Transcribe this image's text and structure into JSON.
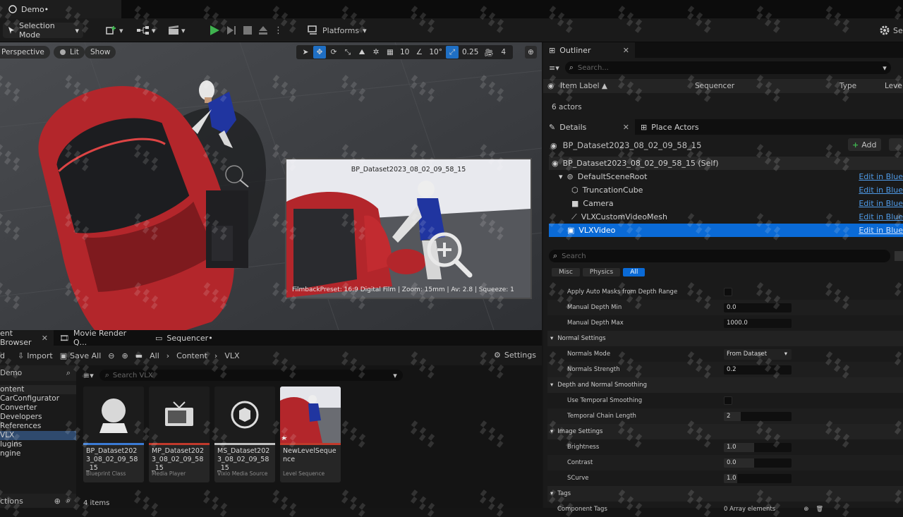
{
  "app": {
    "doc_tab": "Demo•"
  },
  "toolbar": {
    "selection_mode": "Selection Mode",
    "platforms": "Platforms",
    "settings": "Sett"
  },
  "viewport": {
    "perspective": "Perspective",
    "lit": "Lit",
    "show": "Show",
    "grid_snap": "10",
    "angle_snap": "10°",
    "scale_snap": "0.25",
    "cam_speed": "4",
    "pip_title": "BP_Dataset2023_08_02_09_58_15",
    "pip_footer": "FilmbackPreset: 16:9 Digital Film | Zoom: 15mm | Av: 2.8 | Squeeze: 1"
  },
  "content_browser": {
    "tabs": [
      {
        "label": "ent Browser"
      },
      {
        "label": "Movie Render Q..."
      },
      {
        "label": "Sequencer•"
      }
    ],
    "add": "d",
    "import": "Import",
    "save_all": "Save All",
    "path": [
      "All",
      "Content",
      "VLX"
    ],
    "settings": "Settings",
    "search_placeholder": "Search VLX",
    "tree_root": "Demo",
    "tree": [
      {
        "label": "ontent"
      },
      {
        "label": "CarConfigurator"
      },
      {
        "label": "Converter"
      },
      {
        "label": "Developers"
      },
      {
        "label": "References"
      },
      {
        "label": "VLX"
      },
      {
        "label": "lugins"
      },
      {
        "label": "ngine"
      }
    ],
    "collections": "ctions",
    "item_count": "4 items",
    "assets": [
      {
        "name": "BP_Dataset2023_08_02_09_58_15",
        "type": "Blueprint Class",
        "color": "#3a7bd5"
      },
      {
        "name": "MP_Dataset2023_08_02_09_58_15",
        "type": "Media Player",
        "color": "#c0392b"
      },
      {
        "name": "MS_Dataset2023_08_02_09_58_15",
        "type": "Vlxio Media Source",
        "color": "#c0c0c0"
      },
      {
        "name": "NewLevelSequence",
        "type": "Level Sequence",
        "color": "#c0392b"
      }
    ]
  },
  "outliner": {
    "tab": "Outliner",
    "search_placeholder": "Search...",
    "columns": [
      "Item Label ▲",
      "Sequencer",
      "Type",
      "Leve"
    ],
    "actors": "6 actors"
  },
  "details": {
    "tab": "Details",
    "tab2": "Place Actors",
    "actor": "BP_Dataset2023_08_02_09_58_15",
    "add": "Add",
    "components": [
      {
        "label": "BP_Dataset2023_08_02_09_58_15 (Self)",
        "link": "",
        "indent": 0
      },
      {
        "label": "DefaultSceneRoot",
        "link": "Edit in Blue",
        "indent": 1
      },
      {
        "label": "TruncationCube",
        "link": "Edit in Blue",
        "indent": 2
      },
      {
        "label": "Camera",
        "link": "Edit in Blue",
        "indent": 2
      },
      {
        "label": "VLXCustomVideoMesh",
        "link": "Edit in Blue",
        "indent": 2
      },
      {
        "label": "VLXVideo",
        "link": "Edit in Blue",
        "indent": 1
      }
    ],
    "search_placeholder": "Search",
    "filters": [
      "Misc",
      "Physics",
      "All"
    ],
    "props_top": [
      {
        "label": "Apply Auto Masks from Depth Range",
        "kind": "check"
      },
      {
        "label": "Manual Depth Min",
        "value": "0.0"
      },
      {
        "label": "Manual Depth Max",
        "value": "1000.0"
      }
    ],
    "normal_settings": "Normal Settings",
    "normals_mode_label": "Normals Mode",
    "normals_mode_value": "From Dataset",
    "normals_strength_label": "Normals Strength",
    "normals_strength_value": "0.2",
    "depth_normal": "Depth and Normal Smoothing",
    "temporal_smoothing": "Use Temporal Smoothing",
    "temporal_chain": "Temporal Chain Length",
    "temporal_chain_value": "2",
    "image_settings": "Image Settings",
    "brightness": "Brightness",
    "brightness_value": "1.0",
    "contrast": "Contrast",
    "contrast_value": "0.0",
    "scurve": "SCurve",
    "scurve_value": "1.0",
    "tags": "Tags",
    "component_tags": "Component Tags",
    "array_elements": "0 Array elements"
  },
  "colors": {
    "accent": "#1f6fc4",
    "link": "#4f9be8",
    "car": "#b3262b",
    "play": "#3fb34f"
  }
}
